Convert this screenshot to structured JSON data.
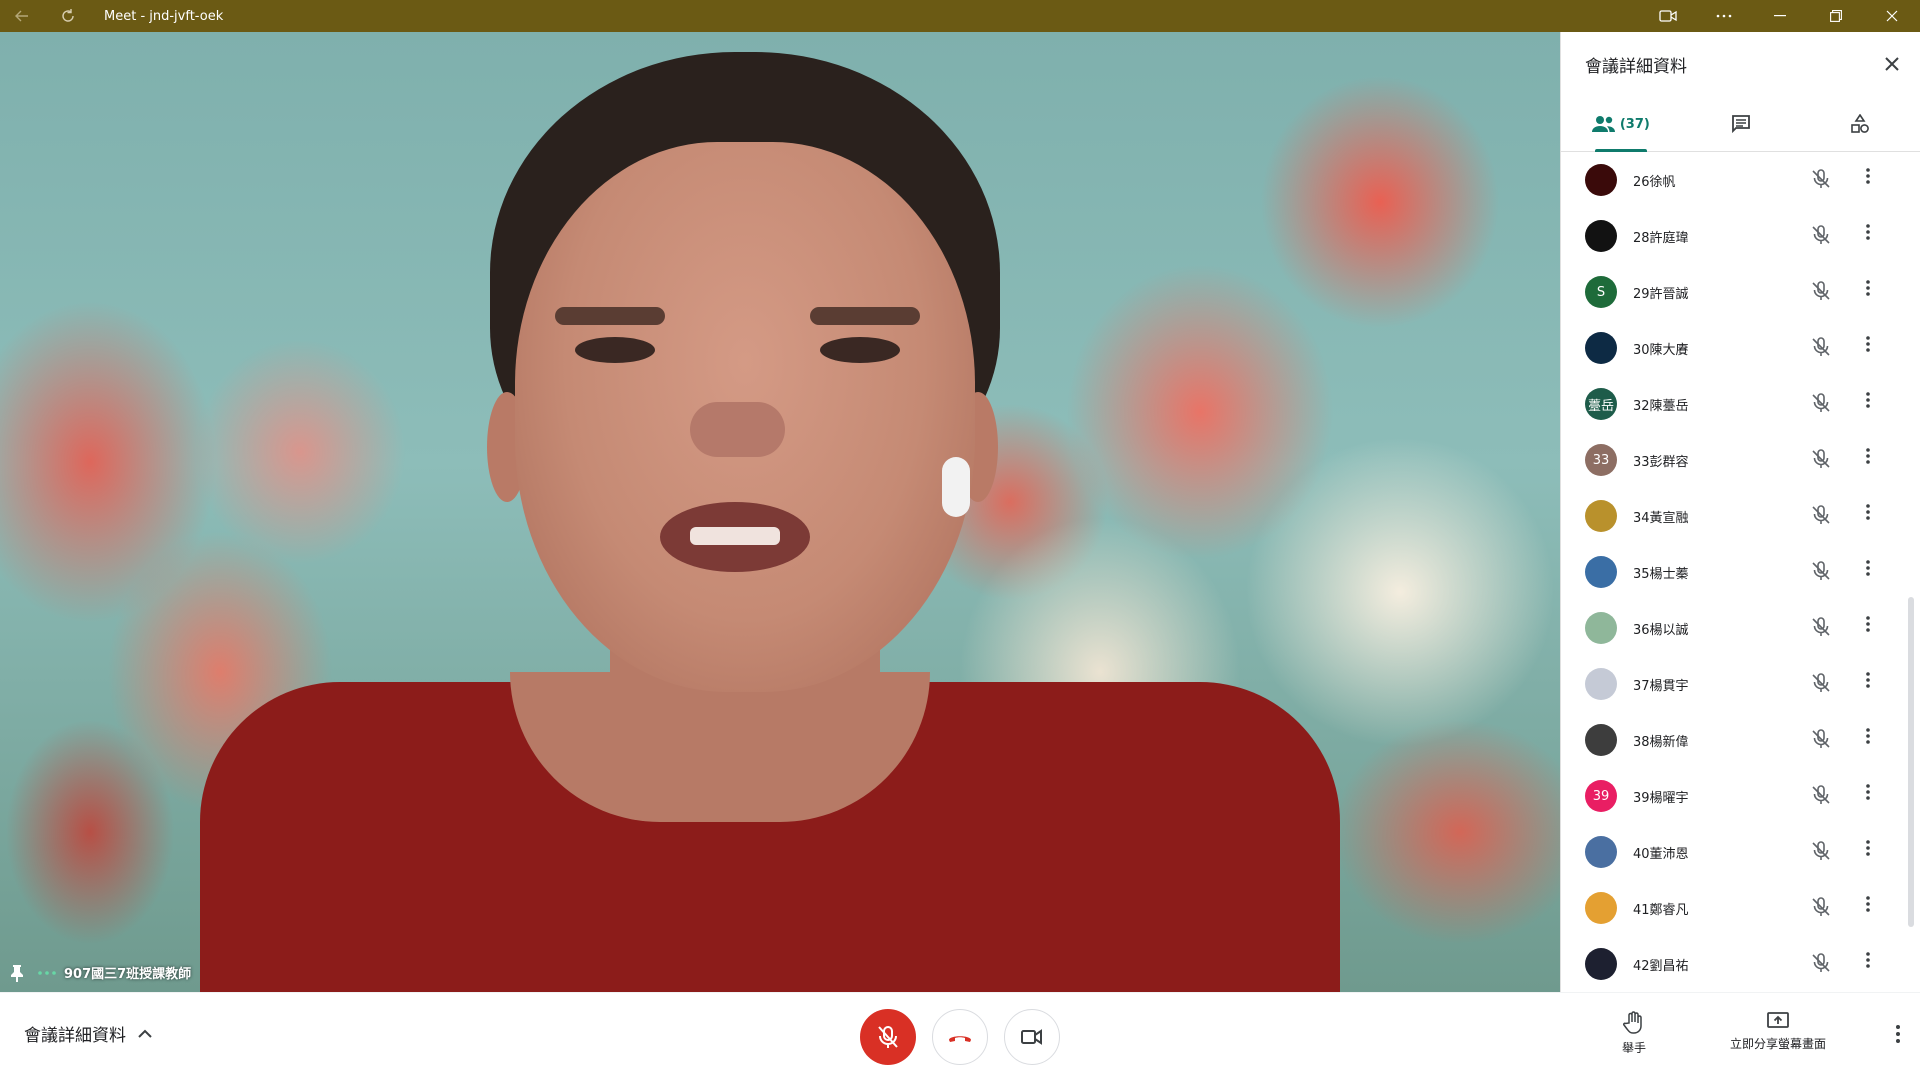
{
  "window": {
    "title": "Meet - jnd-jvft-oek"
  },
  "speaker": {
    "name": "907國三7班授課教師"
  },
  "panel": {
    "title": "會議詳細資料",
    "people_count": "(37)",
    "participants": [
      {
        "name": "26徐帆",
        "avatar_text": "",
        "avatar_color": "#3a0a0a"
      },
      {
        "name": "28許庭瑋",
        "avatar_text": "",
        "avatar_color": "#121212"
      },
      {
        "name": "29許晉誠",
        "avatar_text": "S",
        "avatar_color": "#1e6b3a"
      },
      {
        "name": "30陳大賡",
        "avatar_text": "",
        "avatar_color": "#0d2a44"
      },
      {
        "name": "32陳薹岳",
        "avatar_text": "薹岳",
        "avatar_color": "#1e5c4a"
      },
      {
        "name": "33彭群容",
        "avatar_text": "33",
        "avatar_color": "#8d6e63"
      },
      {
        "name": "34黃宣融",
        "avatar_text": "",
        "avatar_color": "#b9912c"
      },
      {
        "name": "35楊士蓁",
        "avatar_text": "",
        "avatar_color": "#3a6ea5"
      },
      {
        "name": "36楊以誠",
        "avatar_text": "",
        "avatar_color": "#8fb79a"
      },
      {
        "name": "37楊貫宇",
        "avatar_text": "",
        "avatar_color": "#c5cad6"
      },
      {
        "name": "38楊新偉",
        "avatar_text": "",
        "avatar_color": "#3d3d3d"
      },
      {
        "name": "39楊曜宇",
        "avatar_text": "39",
        "avatar_color": "#e91e63"
      },
      {
        "name": "40董沛恩",
        "avatar_text": "",
        "avatar_color": "#4a6fa1"
      },
      {
        "name": "41鄭睿凡",
        "avatar_text": "",
        "avatar_color": "#e4a032"
      },
      {
        "name": "42劉昌祐",
        "avatar_text": "",
        "avatar_color": "#1d2030"
      }
    ]
  },
  "bottom": {
    "meeting_details_label": "會議詳細資料",
    "raise_hand_label": "舉手",
    "present_label": "立即分享螢幕畫面"
  },
  "colors": {
    "titlebar": "#6b5a14",
    "accent": "#0f7b6c",
    "mic_off_red": "#d93025",
    "hangup_red": "#d93025"
  },
  "icons": {
    "back": "back-arrow-icon",
    "refresh": "refresh-icon",
    "camera": "video-camera-icon",
    "people": "people-icon",
    "chat": "chat-icon",
    "activities": "shapes-icon",
    "mic_off": "mic-off-icon",
    "more": "more-vert-icon",
    "pin": "pin-icon",
    "hand": "raise-hand-icon",
    "present": "present-screen-icon"
  }
}
